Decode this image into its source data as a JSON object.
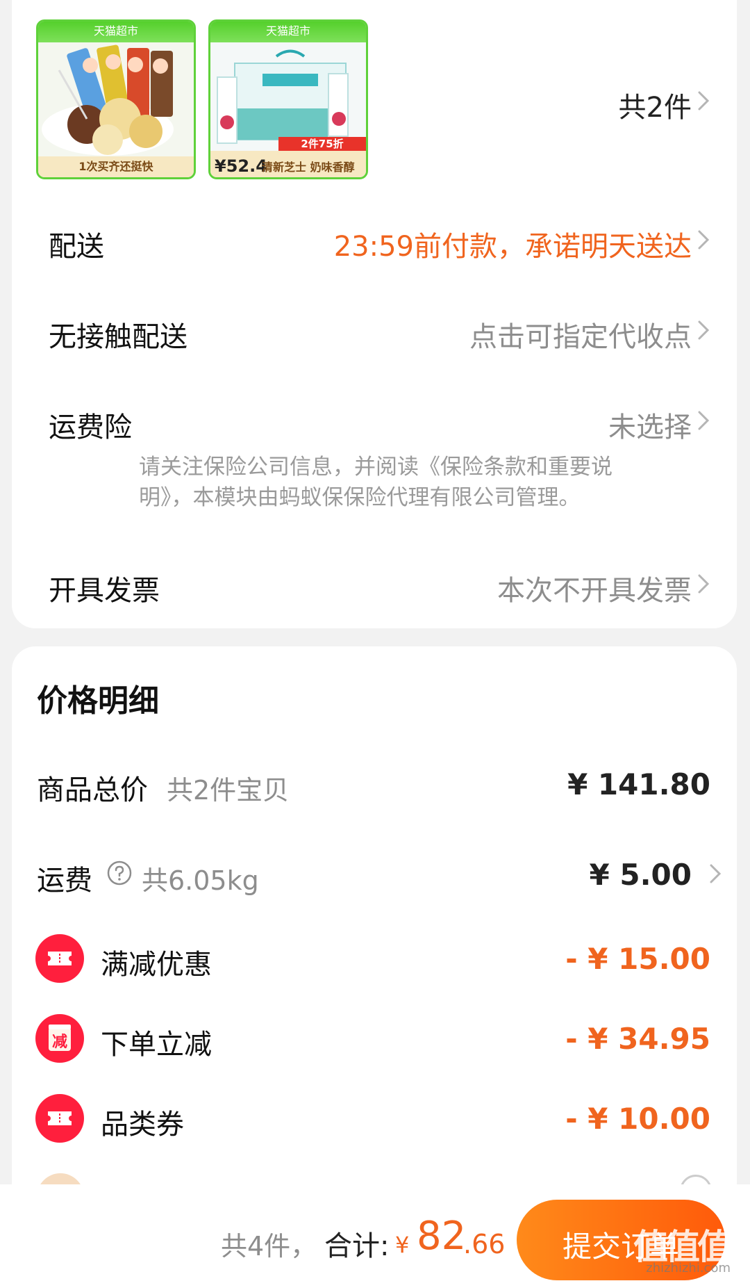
{
  "order_items": {
    "products": [
      {
        "badge": "天猫超市",
        "caption": "1次买齐还挺快"
      },
      {
        "badge": "天猫超市",
        "price": "¥52.4",
        "caption": "清新芝士 奶味香醇",
        "promo": "2件75折"
      }
    ],
    "count_label": "共2件"
  },
  "delivery": {
    "label": "配送",
    "value": "23:59前付款，承诺明天送达"
  },
  "contactless": {
    "label": "无接触配送",
    "value": "点击可指定代收点"
  },
  "shipping_insurance": {
    "label": "运费险",
    "value": "未选择",
    "notice_line1": "请关注保险公司信息，并阅读《保险条款和重要说",
    "notice_line2": "明》，本模块由蚂蚁保保险代理有限公司管理。"
  },
  "invoice": {
    "label": "开具发票",
    "value": "本次不开具发票"
  },
  "price_detail": {
    "title": "价格明细",
    "subtotal": {
      "label": "商品总价",
      "sub": "共2件宝贝",
      "amount": "¥ 141.80"
    },
    "freight": {
      "label": "运费",
      "sub": "共6.05kg",
      "amount": "¥ 5.00"
    },
    "discounts": [
      {
        "icon": "coupon-ticket-icon",
        "label": "满减优惠",
        "amount": "- ¥ 15.00"
      },
      {
        "icon": "instant-reduction-icon",
        "icon_text": "减",
        "label": "下单立减",
        "amount": "- ¥ 34.95"
      },
      {
        "icon": "coupon-ticket-icon",
        "label": "品类券",
        "amount": "- ¥ 10.00"
      }
    ]
  },
  "bottom_bar": {
    "count": "共4件，",
    "total_label": "合计:",
    "currency": "¥",
    "total_int": "82",
    "total_dec": ".66",
    "submit_label": "提交订单"
  },
  "watermark": {
    "text": "值值值",
    "url": "zhizhizhi.com"
  },
  "colors": {
    "accent_orange": "#f0641e",
    "discount_red": "#ff1f3d",
    "muted_gray": "#8d8d8d"
  }
}
